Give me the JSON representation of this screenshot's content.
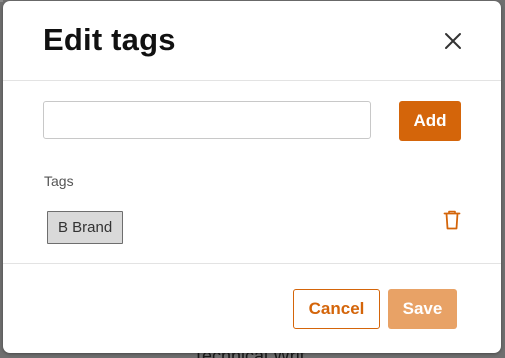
{
  "modal": {
    "title": "Edit tags",
    "input": {
      "value": "",
      "placeholder": ""
    },
    "add_label": "Add",
    "tags_label": "Tags",
    "tags": [
      {
        "label": "B Brand"
      }
    ],
    "cancel_label": "Cancel",
    "save_label": "Save"
  },
  "background": {
    "peek_text": "Technical Writ"
  },
  "colors": {
    "accent": "#d4650a",
    "accent_disabled": "#e8a266",
    "overlay": "#6f6f6f"
  },
  "icons": {
    "close": "close-icon",
    "delete": "trash-icon"
  }
}
